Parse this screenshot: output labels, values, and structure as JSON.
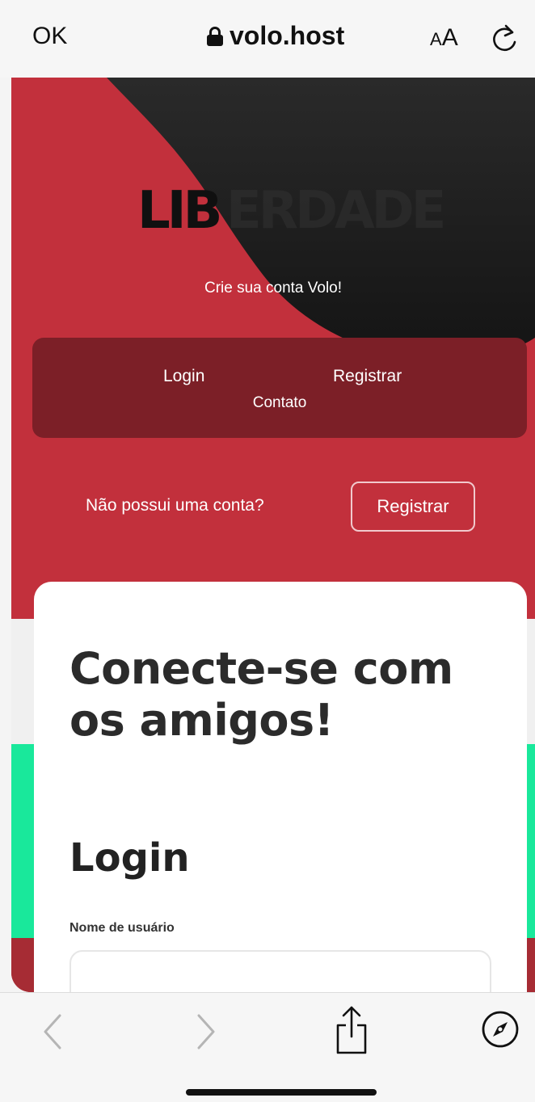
{
  "browser": {
    "done_label": "OK",
    "url": "volo.host",
    "text_size_small": "A",
    "text_size_big": "A"
  },
  "site": {
    "logo_text": "LIBERDADE",
    "logo_strong": "LIB",
    "logo_faint": "ERDADE",
    "tagline": "Crie sua conta Volo!",
    "nav": {
      "login": "Login",
      "register": "Registrar",
      "contact": "Contato"
    },
    "prompt": {
      "text": "Não possui uma conta?",
      "button": "Registrar"
    },
    "card": {
      "headline": "Conecte-se com os amigos!",
      "form_title": "Login",
      "username_label": "Nome de usuário",
      "username_value": ""
    }
  },
  "colors": {
    "brand_red": "#c2303c",
    "nav_dark_red": "#7c1f27",
    "accent_green": "#19e89b",
    "blob_black": "#1c1c1c"
  },
  "icons": {
    "lock": "lock-icon",
    "reload": "reload-icon",
    "back": "chevron-left-icon",
    "forward": "chevron-right-icon",
    "share": "share-icon",
    "compass": "compass-icon"
  }
}
